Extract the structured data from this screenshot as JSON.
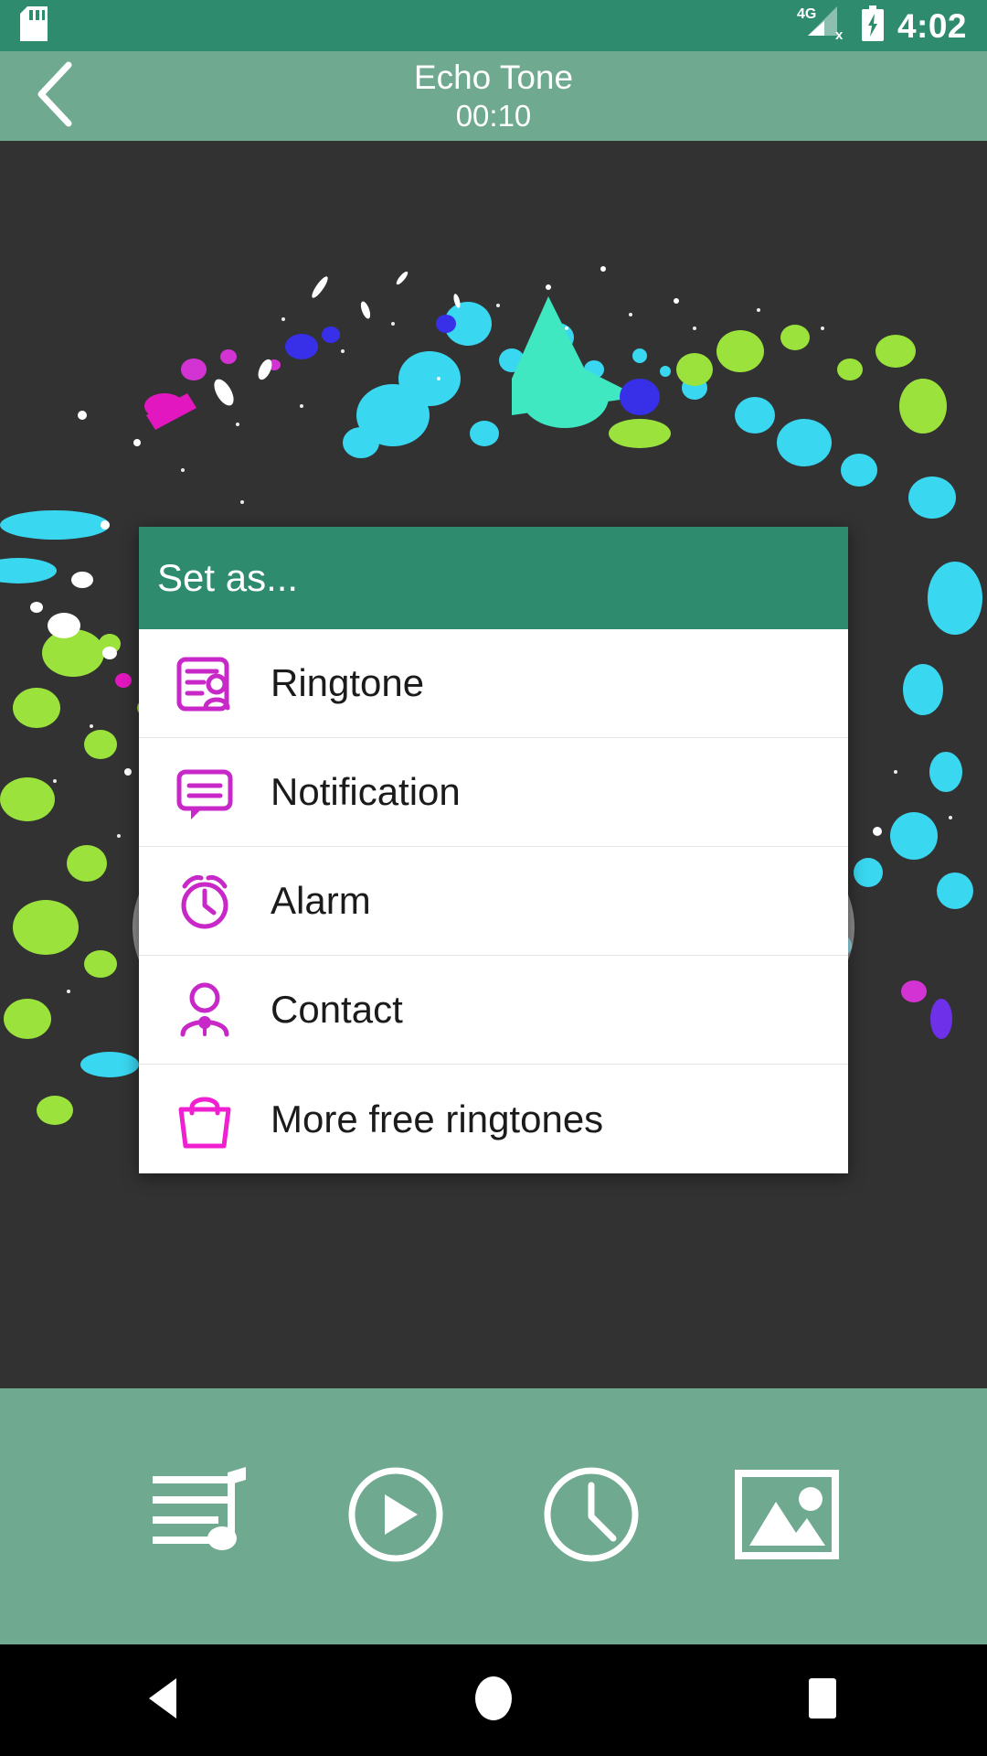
{
  "statusbar": {
    "sd_icon": "sd-card-icon",
    "network_label": "4G",
    "signal_icon": "signal-no-service-icon",
    "battery_icon": "battery-charging-icon",
    "time": "4:02"
  },
  "appbar": {
    "back_icon": "back-chevron-icon",
    "title": "Echo Tone",
    "duration": "00:10"
  },
  "artwork": {
    "name": "paint-splatter-artwork",
    "background_color": "#333232"
  },
  "dialog": {
    "title": "Set as...",
    "header_color": "#2E8B6E",
    "icon_color": "#C728C7",
    "items": [
      {
        "label": "Ringtone",
        "icon": "contact-card-icon"
      },
      {
        "label": "Notification",
        "icon": "speech-bubble-icon"
      },
      {
        "label": "Alarm",
        "icon": "alarm-clock-icon"
      },
      {
        "label": "Contact",
        "icon": "person-icon"
      },
      {
        "label": "More free ringtones",
        "icon": "shopping-bag-icon"
      }
    ]
  },
  "toolbar": {
    "background_color": "#6FA98F",
    "buttons": [
      {
        "name": "playlist-music-icon"
      },
      {
        "name": "play-circle-icon"
      },
      {
        "name": "clock-icon"
      },
      {
        "name": "image-icon"
      }
    ]
  },
  "navbar": {
    "back": "nav-back-triangle-icon",
    "home": "nav-home-circle-icon",
    "recents": "nav-recents-square-icon"
  },
  "theme": {
    "status_green": "#2E8B6E",
    "bar_green": "#6FA98F",
    "magenta": "#C728C7",
    "magenta_bright": "#F020D0"
  }
}
